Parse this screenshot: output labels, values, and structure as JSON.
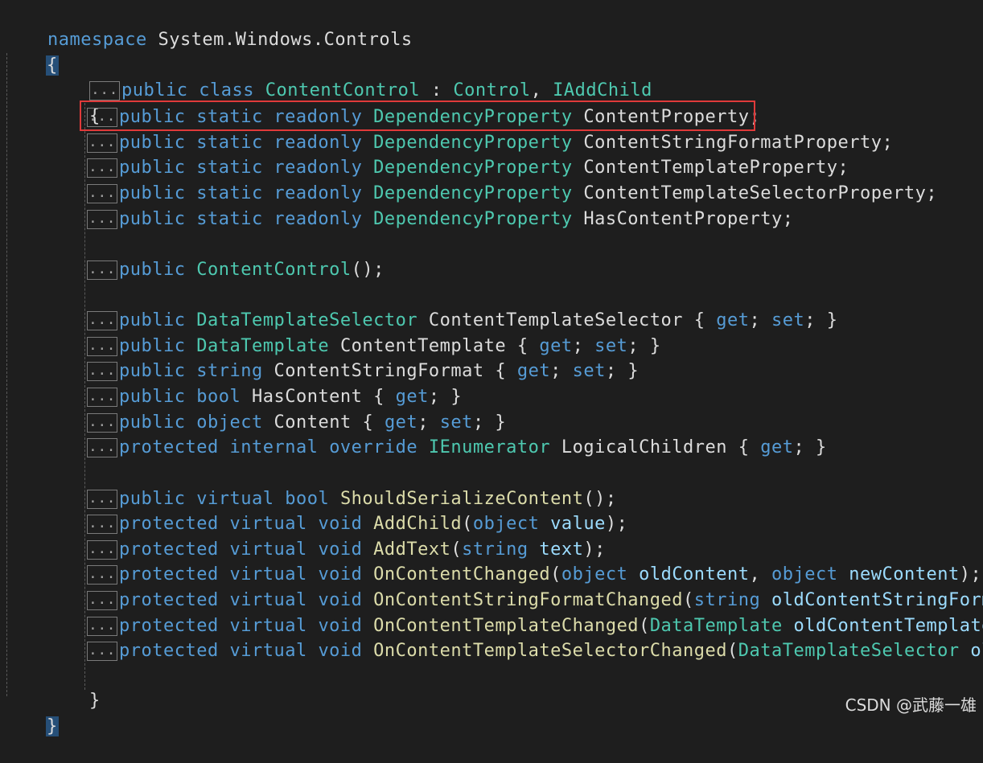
{
  "code": {
    "ns_keyword": "namespace",
    "ns_name": "System.Windows.Controls",
    "open_brace": "{",
    "close_brace": "}",
    "fold_marker": "...",
    "class_line": {
      "mod1": "public",
      "mod2": "class",
      "name": "ContentControl",
      "sep": " : ",
      "base": "Control",
      "comma": ", ",
      "iface": "IAddChild"
    },
    "fields": [
      {
        "mods": "public static readonly",
        "type": "DependencyProperty",
        "name": "ContentProperty;"
      },
      {
        "mods": "public static readonly",
        "type": "DependencyProperty",
        "name": "ContentStringFormatProperty;"
      },
      {
        "mods": "public static readonly",
        "type": "DependencyProperty",
        "name": "ContentTemplateProperty;"
      },
      {
        "mods": "public static readonly",
        "type": "DependencyProperty",
        "name": "ContentTemplateSelectorProperty;"
      },
      {
        "mods": "public static readonly",
        "type": "DependencyProperty",
        "name": "HasContentProperty;"
      }
    ],
    "ctor": {
      "mod": "public",
      "name": "ContentControl",
      "rest": "();"
    },
    "properties": [
      {
        "mods": "public",
        "type": "DataTemplateSelector",
        "typeIsKeyword": false,
        "name": "ContentTemplateSelector",
        "body": [
          "{ ",
          "get",
          "; ",
          "set",
          "; }"
        ]
      },
      {
        "mods": "public",
        "type": "DataTemplate",
        "typeIsKeyword": false,
        "name": "ContentTemplate",
        "body": [
          "{ ",
          "get",
          "; ",
          "set",
          "; }"
        ]
      },
      {
        "mods": "public",
        "type": "string",
        "typeIsKeyword": true,
        "name": "ContentStringFormat",
        "body": [
          "{ ",
          "get",
          "; ",
          "set",
          "; }"
        ]
      },
      {
        "mods": "public",
        "type": "bool",
        "typeIsKeyword": true,
        "name": "HasContent",
        "body": [
          "{ ",
          "get",
          "; }"
        ]
      },
      {
        "mods": "public",
        "type": "object",
        "typeIsKeyword": true,
        "name": "Content",
        "body": [
          "{ ",
          "get",
          "; ",
          "set",
          "; }"
        ]
      },
      {
        "mods": "protected internal override",
        "type": "IEnumerator",
        "typeIsKeyword": false,
        "name": "LogicalChildren",
        "body": [
          "{ ",
          "get",
          "; }"
        ]
      }
    ],
    "methods": [
      {
        "mods": "public virtual",
        "ret": "bool",
        "name": "ShouldSerializeContent",
        "params": [],
        "tail": "();"
      },
      {
        "mods": "protected virtual",
        "ret": "void",
        "name": "AddChild",
        "params": [
          {
            "t": "object",
            "k": true,
            "n": "value"
          }
        ],
        "tail": ");"
      },
      {
        "mods": "protected virtual",
        "ret": "void",
        "name": "AddText",
        "params": [
          {
            "t": "string",
            "k": true,
            "n": "text"
          }
        ],
        "tail": ");"
      },
      {
        "mods": "protected virtual",
        "ret": "void",
        "name": "OnContentChanged",
        "params": [
          {
            "t": "object",
            "k": true,
            "n": "oldContent"
          },
          {
            "t": "object",
            "k": true,
            "n": "newContent"
          }
        ],
        "tail": ");"
      },
      {
        "mods": "protected virtual",
        "ret": "void",
        "name": "OnContentStringFormatChanged",
        "params": [
          {
            "t": "string",
            "k": true,
            "n": "oldContentStringFormat"
          }
        ],
        "tail": ""
      },
      {
        "mods": "protected virtual",
        "ret": "void",
        "name": "OnContentTemplateChanged",
        "params": [
          {
            "t": "DataTemplate",
            "k": false,
            "n": "oldContentTemplate"
          }
        ],
        "tail": ","
      },
      {
        "mods": "protected virtual",
        "ret": "void",
        "name": "OnContentTemplateSelectorChanged",
        "params": [
          {
            "t": "DataTemplateSelector",
            "k": false,
            "n": "oldC"
          }
        ],
        "tail": ""
      }
    ]
  },
  "watermark": "CSDN @武藤一雄",
  "colors": {
    "background": "#1e1e1e",
    "keyword": "#569cd6",
    "type": "#4ec9b0",
    "method": "#dcdcaa",
    "parameter": "#9cdcfe",
    "highlight_box": "#e03a3a"
  }
}
